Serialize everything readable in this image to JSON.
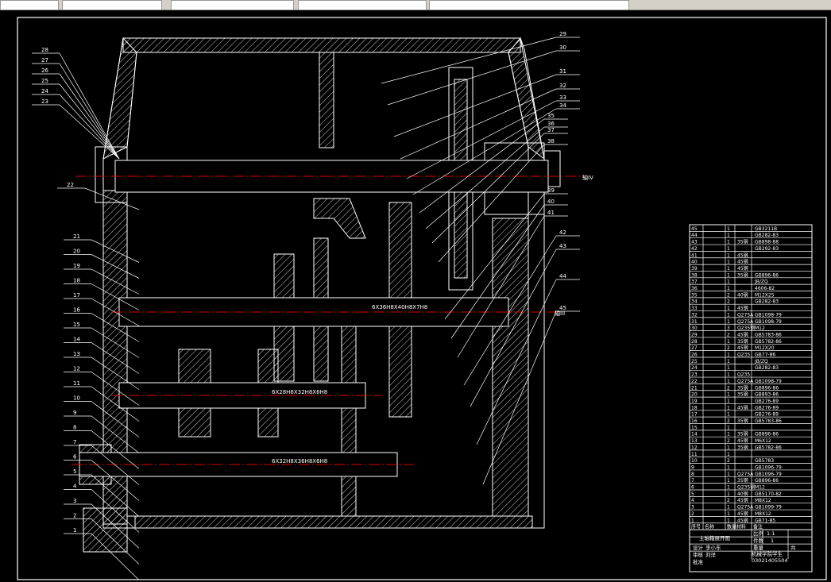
{
  "tabs": [
    "",
    "",
    "",
    "",
    ""
  ],
  "drawing": {
    "left_callouts": [
      "28",
      "27",
      "26",
      "25",
      "24",
      "23",
      "22",
      "21",
      "20",
      "19",
      "18",
      "17",
      "16",
      "15",
      "14",
      "13",
      "12",
      "11",
      "10",
      "9",
      "8",
      "7",
      "6",
      "5",
      "4",
      "3",
      "2",
      "1"
    ],
    "right_callouts": [
      "29",
      "30",
      "31",
      "32",
      "33",
      "34",
      "35",
      "36",
      "37",
      "38",
      "39",
      "40",
      "41",
      "42",
      "43",
      "44",
      "45"
    ],
    "shaft_labels": [
      "6X36H8X40H8X7H8",
      "6X28H8X32H8X6H8",
      "6X32H8X36H8X6H8"
    ],
    "shaft_ends": [
      "轴IV",
      "轴III"
    ]
  },
  "parts_table": {
    "rows": [
      [
        "45",
        "1",
        "",
        "GB3211B"
      ],
      [
        "44",
        "1",
        "",
        "GB282-83"
      ],
      [
        "43",
        "1",
        "35钢",
        "GB898-88"
      ],
      [
        "42",
        "1",
        "",
        "GB292-83"
      ],
      [
        "41",
        "1",
        "45钢",
        ""
      ],
      [
        "40",
        "1",
        "45钢",
        ""
      ],
      [
        "39",
        "1",
        "45钢",
        ""
      ],
      [
        "38",
        "1",
        "35钢",
        "GB896-86"
      ],
      [
        "37",
        "1",
        "",
        "JB/ZQ"
      ],
      [
        "36",
        "1",
        "",
        "4606-82"
      ],
      [
        "35",
        "2",
        "40钢",
        "M12X25"
      ],
      [
        "34",
        "2",
        "",
        "GB282-83"
      ],
      [
        "33",
        "1",
        "45钢",
        ""
      ],
      [
        "32",
        "1",
        "Q275A",
        "GB1098-79"
      ],
      [
        "31",
        "1",
        "Q275A",
        "GB1098-79"
      ],
      [
        "30",
        "3",
        "Q235钢",
        "M12"
      ],
      [
        "29",
        "2",
        "45钢",
        "GB5783-86"
      ],
      [
        "28",
        "1",
        "35钢",
        "GB5782-86"
      ],
      [
        "27",
        "2",
        "45钢",
        "M12X20"
      ],
      [
        "26",
        "1",
        "Q235",
        "GB77-86"
      ],
      [
        "25",
        "1",
        "",
        "JB/ZQ"
      ],
      [
        "24",
        "1",
        "",
        "GB282-83"
      ],
      [
        "23",
        "1",
        "Q235",
        ""
      ],
      [
        "22",
        "1",
        "Q275A",
        "GB1098-79"
      ],
      [
        "21",
        "2",
        "35钢",
        "GB896-86"
      ],
      [
        "20",
        "1",
        "35钢",
        "GB893-86"
      ],
      [
        "19",
        "1",
        "",
        "GB276-89"
      ],
      [
        "18",
        "1",
        "45钢",
        "GB276-89"
      ],
      [
        "17",
        "1",
        "",
        "GB276-89"
      ],
      [
        "16",
        "2",
        "35钢",
        "GB5783-86"
      ],
      [
        "15",
        "1",
        "",
        ""
      ],
      [
        "14",
        "1",
        "35钢",
        "GB896-86"
      ],
      [
        "13",
        "2",
        "45钢",
        "M6X12"
      ],
      [
        "12",
        "1",
        "35钢",
        "GB5782-86"
      ],
      [
        "11",
        "1",
        "",
        ""
      ],
      [
        "10",
        "2",
        "",
        "GB5783"
      ],
      [
        "9",
        "1",
        "",
        "GB1096-79"
      ],
      [
        "8",
        "1",
        "Q275A",
        "GB1096-79"
      ],
      [
        "7",
        "1",
        "35钢",
        "GB896-86"
      ],
      [
        "6",
        "1",
        "Q235钢",
        "M12"
      ],
      [
        "5",
        "1",
        "40钢",
        "GB5170-82"
      ],
      [
        "4",
        "2",
        "45钢",
        "M8X12"
      ],
      [
        "3",
        "1",
        "Q275A",
        "GB1099-79"
      ],
      [
        "2",
        "1",
        "45钢",
        "M8X12"
      ],
      [
        "1",
        "1",
        "45钢",
        "GB71-85"
      ]
    ],
    "header": [
      "序号",
      "名称",
      "数量",
      "材料",
      "备注"
    ],
    "title": "主轴箱展开图",
    "scale_label": "比例",
    "scale": "1:1",
    "count_label": "件数",
    "count": "1",
    "designer_label": "设计",
    "designer": "李小东",
    "weight_label": "重量",
    "sheet_label": "共",
    "checker_label": "审核",
    "checker": "刘洋",
    "approver_label": "批准",
    "school": "机械学院学生",
    "drawing_no": "03021405504"
  }
}
